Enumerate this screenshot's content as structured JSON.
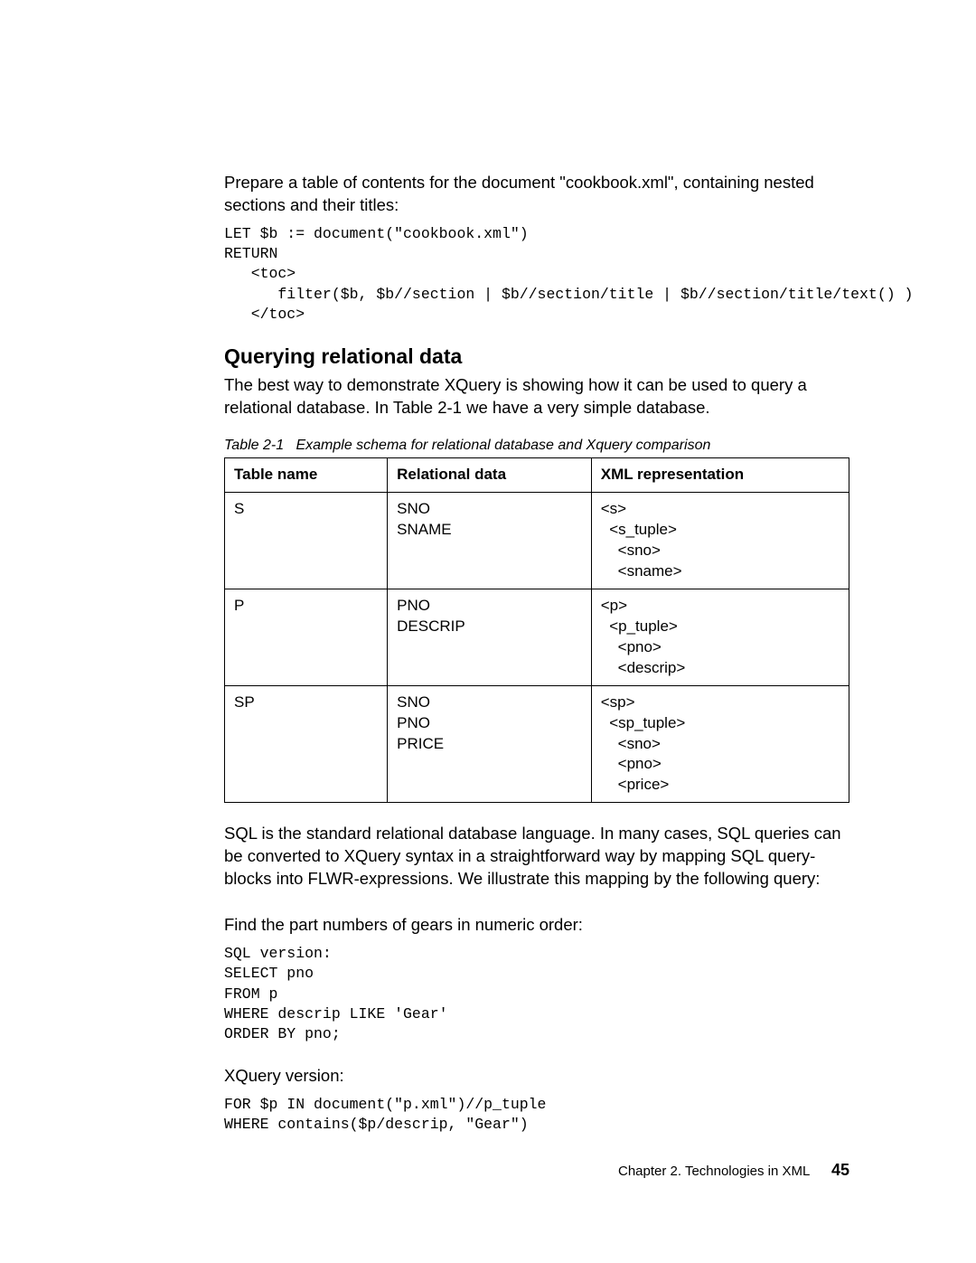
{
  "intro": {
    "paragraph": "Prepare a table of contents for the document \"cookbook.xml\", containing nested sections and their titles:",
    "code": "LET $b := document(\"cookbook.xml\")\nRETURN\n   <toc>\n      filter($b, $b//section | $b//section/title | $b//section/title/text() )\n   </toc>"
  },
  "section": {
    "heading": "Querying relational data",
    "paragraph": "The best way to demonstrate XQuery is showing how it can be used to query a relational database. In Table 2-1 we have a very simple database."
  },
  "table": {
    "caption": "Table 2-1   Example schema for relational database and Xquery comparison",
    "headers": [
      "Table name",
      "Relational data",
      "XML representation"
    ],
    "rows": [
      {
        "name": "S",
        "rel": "SNO\nSNAME",
        "xml": "<s>\n  <s_tuple>\n    <sno>\n    <sname>"
      },
      {
        "name": "P",
        "rel": "PNO\nDESCRIP",
        "xml": "<p>\n  <p_tuple>\n    <pno>\n    <descrip>"
      },
      {
        "name": "SP",
        "rel": "SNO\nPNO\nPRICE",
        "xml": "<sp>\n  <sp_tuple>\n    <sno>\n    <pno>\n    <price>"
      }
    ]
  },
  "post_table": {
    "paragraph1": "SQL is the standard relational database language. In many cases, SQL queries can be converted to XQuery syntax in a straightforward way by mapping SQL query-blocks into FLWR-expressions. We illustrate this mapping by the following query:",
    "paragraph2": "Find the part numbers of gears in numeric order:",
    "sql_code": "SQL version:\nSELECT pno\nFROM p\nWHERE descrip LIKE 'Gear'\nORDER BY pno;",
    "xquery_label": "XQuery version:",
    "xquery_code": "FOR $p IN document(\"p.xml\")//p_tuple\nWHERE contains($p/descrip, \"Gear\")"
  },
  "footer": {
    "chapter": "Chapter 2. Technologies in XML",
    "page": "45"
  }
}
